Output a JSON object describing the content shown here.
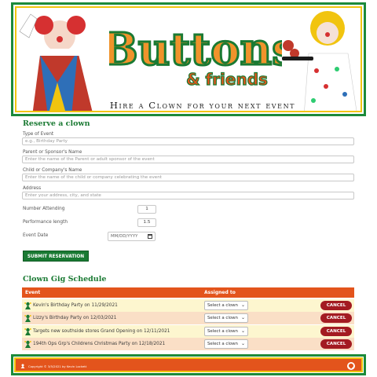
{
  "banner": {
    "logo_word": "Buttons",
    "logo_sub": "& friends",
    "tagline": "Hire a Clown for your next event"
  },
  "form": {
    "title": "Reserve a clown",
    "type_label": "Type of Event",
    "type_placeholder": "e.g., Birthday Party",
    "parent_label": "Parent or Sponsor's Name",
    "parent_placeholder": "Enter the name of the Parent or adult sponsor of the event",
    "child_label": "Child or Company's Name",
    "child_placeholder": "Enter the name of the child or company celebrating the event",
    "address_label": "Address",
    "address_placeholder": "Enter your address, city, and state",
    "attending_label": "Number Attending",
    "attending_value": "1",
    "length_label": "Performance length",
    "length_value": "1.5",
    "date_label": "Event Date",
    "date_placeholder": "MM/DD/YYYY",
    "submit_label": "SUBMIT RESERVATION"
  },
  "schedule": {
    "title": "Clown Gig Schedule",
    "col_event": "Event",
    "col_assigned": "Assigned to",
    "select_label": "Select a clown",
    "cancel_label": "CANCEL",
    "rows": [
      {
        "event": "Kevin's Birthday Party on 11/29/2021"
      },
      {
        "event": "Lizzy's Birthday Party on 12/03/2021"
      },
      {
        "event": "Targets new southside stores Grand Opening on 12/11/2021"
      },
      {
        "event": "194th Ops Grp's Childrens Christmas Party on 12/18/2021"
      }
    ]
  },
  "footer": {
    "copyright": "Copyright © 3/5/2021 by Kevin Lockett"
  },
  "colors": {
    "green": "#1a7a33",
    "orange": "#e3541c",
    "yellow": "#f1c40f",
    "cancel_red": "#a31b22"
  }
}
